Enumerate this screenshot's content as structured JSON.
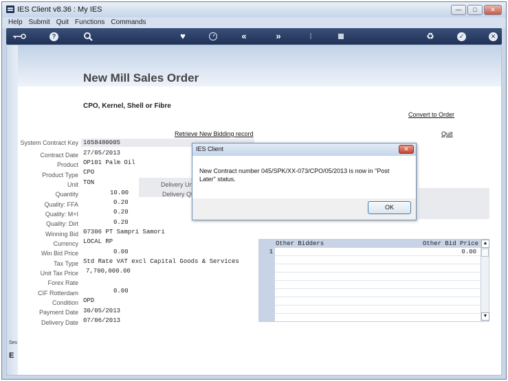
{
  "window": {
    "title": "IES Client v8.36 : My IES"
  },
  "menu": [
    "Help",
    "Submit",
    "Quit",
    "Functions",
    "Commands"
  ],
  "toolbar_icons": [
    "key-icon",
    "help-icon",
    "search-icon",
    "heart-icon",
    "clock-icon",
    "rewind-icon",
    "fast-forward-icon",
    "text-cursor-icon",
    "stop-icon",
    "recycle-icon",
    "check-icon",
    "close-icon"
  ],
  "page": {
    "title": "New Mill Sales Order",
    "subtitle": "CPO, Kernel, Shell or Fibre",
    "convert_link": "Convert to Order",
    "retrieve_link": "Retrieve New Bidding record",
    "quit_link": "Quit"
  },
  "fields": [
    {
      "label": "System Contract Key",
      "value": "1658480005"
    },
    {
      "label": "Contract Date",
      "value": "27/05/2013"
    },
    {
      "label": "Product",
      "value": "OP101 Palm Oil"
    },
    {
      "label": "Product Type",
      "value": "CPO"
    },
    {
      "label": "Unit",
      "value": "TON"
    },
    {
      "label": "Quantity",
      "value": "10.00"
    },
    {
      "label": "Quality: FFA",
      "value": "0.20"
    },
    {
      "label": "Quality: M+I",
      "value": "0.20"
    },
    {
      "label": "Quality: Dirt",
      "value": "0.20"
    },
    {
      "label": "Winning Bid",
      "value": "07306 PT Sampri Samori"
    },
    {
      "label": "Currency",
      "value": "LOCAL RP"
    },
    {
      "label": "Win Bid Price",
      "value": "0.00"
    },
    {
      "label": "Tax Type",
      "value": "Std Rate VAT excl Capital Goods & Services"
    },
    {
      "label": "Unit Tax Price",
      "value": "7,700,000.00"
    },
    {
      "label": "Forex Rate",
      "value": ""
    },
    {
      "label": "CIF Rotterdam",
      "value": "0.00"
    },
    {
      "label": "Condition",
      "value": "OPD"
    },
    {
      "label": "Payment Date",
      "value": "30/05/2013"
    },
    {
      "label": "Delivery Date",
      "value": "07/06/2013"
    }
  ],
  "delivery": {
    "unit_label": "Delivery Unit",
    "qty_label": "Delivery Qty"
  },
  "grid": {
    "columns": [
      "Other Bidders",
      "Other Bid Price"
    ],
    "rows": [
      {
        "num": "1",
        "bidder": "",
        "price": "0.00"
      }
    ]
  },
  "dialog": {
    "title": "IES Client",
    "message": "New Contract number 045/SPK/XX-073/CPO/05/2013 is now in \"Post Later\" status.",
    "ok": "OK"
  },
  "sidebar": {
    "ses": "Ses",
    "letter": "E"
  }
}
